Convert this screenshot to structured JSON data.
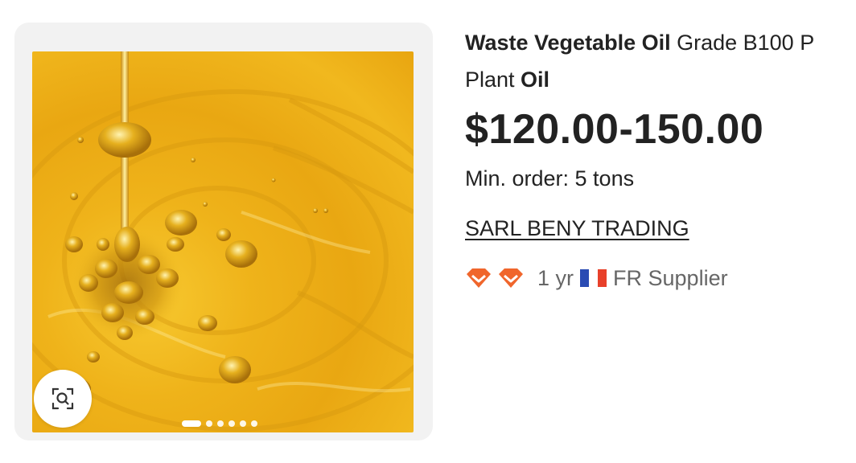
{
  "product": {
    "title_bold_1": "Waste Vegetable Oil",
    "title_normal_1": " Grade B100 P",
    "title_normal_2": "Plant ",
    "title_bold_2": "Oil",
    "price": "$120.00-150.00",
    "min_order": "Min. order: 5 tons",
    "image_alt": "Golden oil with bubbles",
    "gallery_count": 6,
    "gallery_active_index": 0
  },
  "supplier": {
    "name": "SARL BENY TRADING",
    "diamond_count": 2,
    "years": "1 yr",
    "country_label": "FR Supplier",
    "flag_colors": [
      "#2a4bb3",
      "#ffffff",
      "#e8402a"
    ]
  },
  "icons": {
    "visual_search": "image-search-icon",
    "diamond": "diamond-badge-icon"
  },
  "colors": {
    "accent_orange": "#f0662c",
    "text_primary": "#222222",
    "text_secondary": "#666666"
  }
}
